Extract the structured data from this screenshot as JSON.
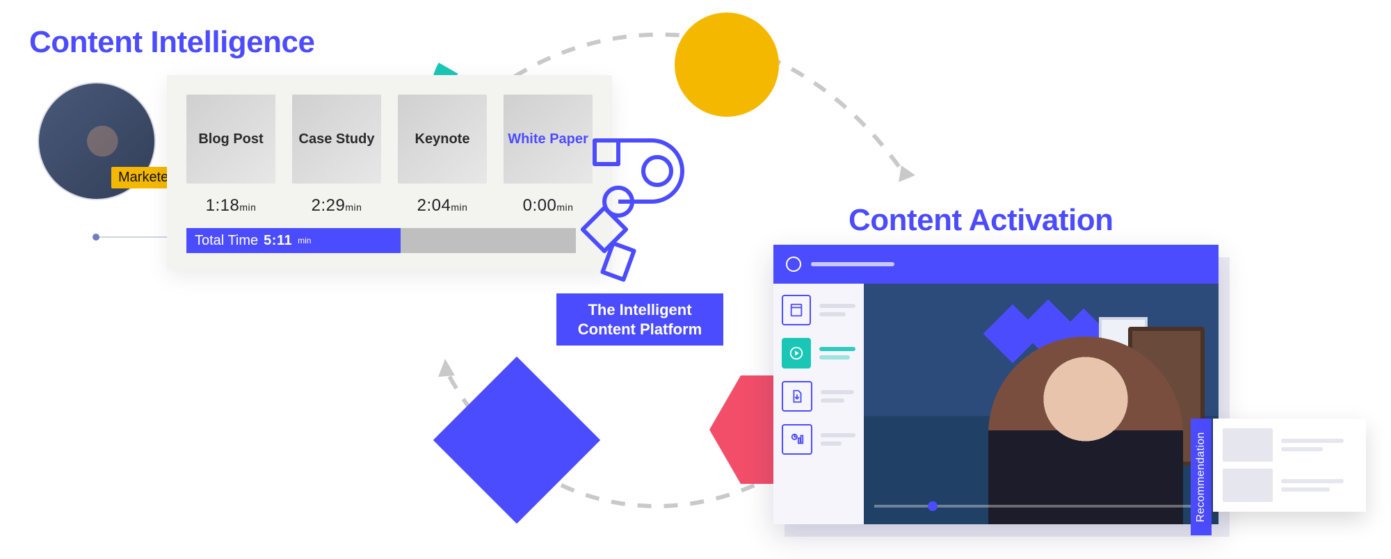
{
  "sections": {
    "intelligence_title": "Content Intelligence",
    "activation_title": "Content Activation"
  },
  "avatar": {
    "role_label": "Marketer"
  },
  "intelligence_card": {
    "tiles": [
      {
        "label": "Blog Post",
        "time_value": "1:18",
        "time_unit": "min",
        "highlight": false
      },
      {
        "label": "Case Study",
        "time_value": "2:29",
        "time_unit": "min",
        "highlight": false
      },
      {
        "label": "Keynote",
        "time_value": "2:04",
        "time_unit": "min",
        "highlight": false
      },
      {
        "label": "White Paper",
        "time_value": "0:00",
        "time_unit": "min",
        "highlight": true
      }
    ],
    "total_label": "Total Time",
    "total_value": "5:11",
    "total_unit": "min",
    "total_fill_pct": 55
  },
  "brand": {
    "tagline": "The Intelligent Content Platform"
  },
  "activation_panel": {
    "recommendation_label": "Recommendation",
    "side_items": [
      {
        "name": "book-icon",
        "active": false
      },
      {
        "name": "play-icon",
        "active": true
      },
      {
        "name": "download-icon",
        "active": false
      },
      {
        "name": "chart-icon",
        "active": false
      }
    ]
  },
  "colors": {
    "accent": "#4C4CFF",
    "teal": "#1AC7B6",
    "yellow": "#F5B800",
    "coral": "#F24E6A"
  }
}
